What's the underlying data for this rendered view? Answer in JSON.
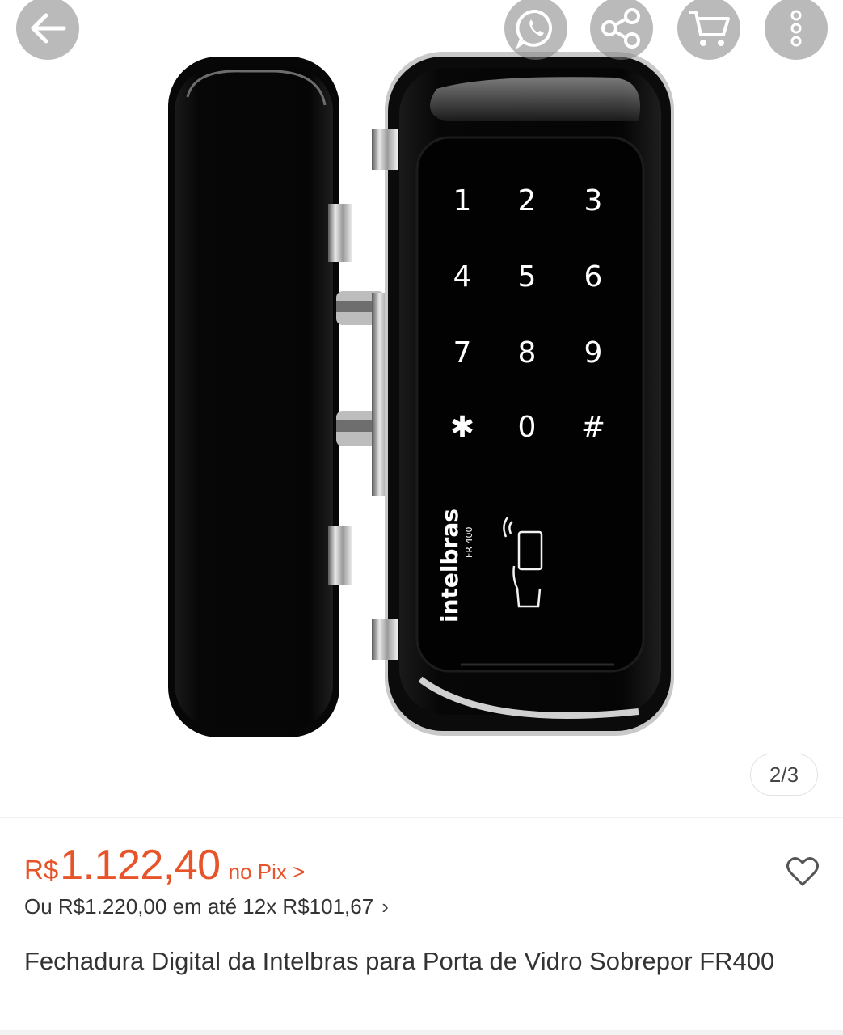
{
  "gallery": {
    "pager": "2/3",
    "keypad": [
      "1",
      "2",
      "3",
      "4",
      "5",
      "6",
      "7",
      "8",
      "9",
      "✱",
      "0",
      "#"
    ],
    "brand": "intelbras",
    "model": "FR 400"
  },
  "toolbar": {
    "back_icon": "arrow-left-icon",
    "whatsapp_icon": "whatsapp-icon",
    "share_icon": "share-icon",
    "cart_icon": "cart-icon",
    "more_icon": "more-vertical-icon"
  },
  "price": {
    "currency": "R$",
    "amount": "1.122,40",
    "pix_label": "no Pix >",
    "color": "#e8542a"
  },
  "installments": {
    "text": "Ou R$1.220,00 em até 12x R$101,67",
    "chevron": "›"
  },
  "product": {
    "title": "Fechadura Digital da Intelbras para Porta de Vidro Sobrepor FR400"
  }
}
